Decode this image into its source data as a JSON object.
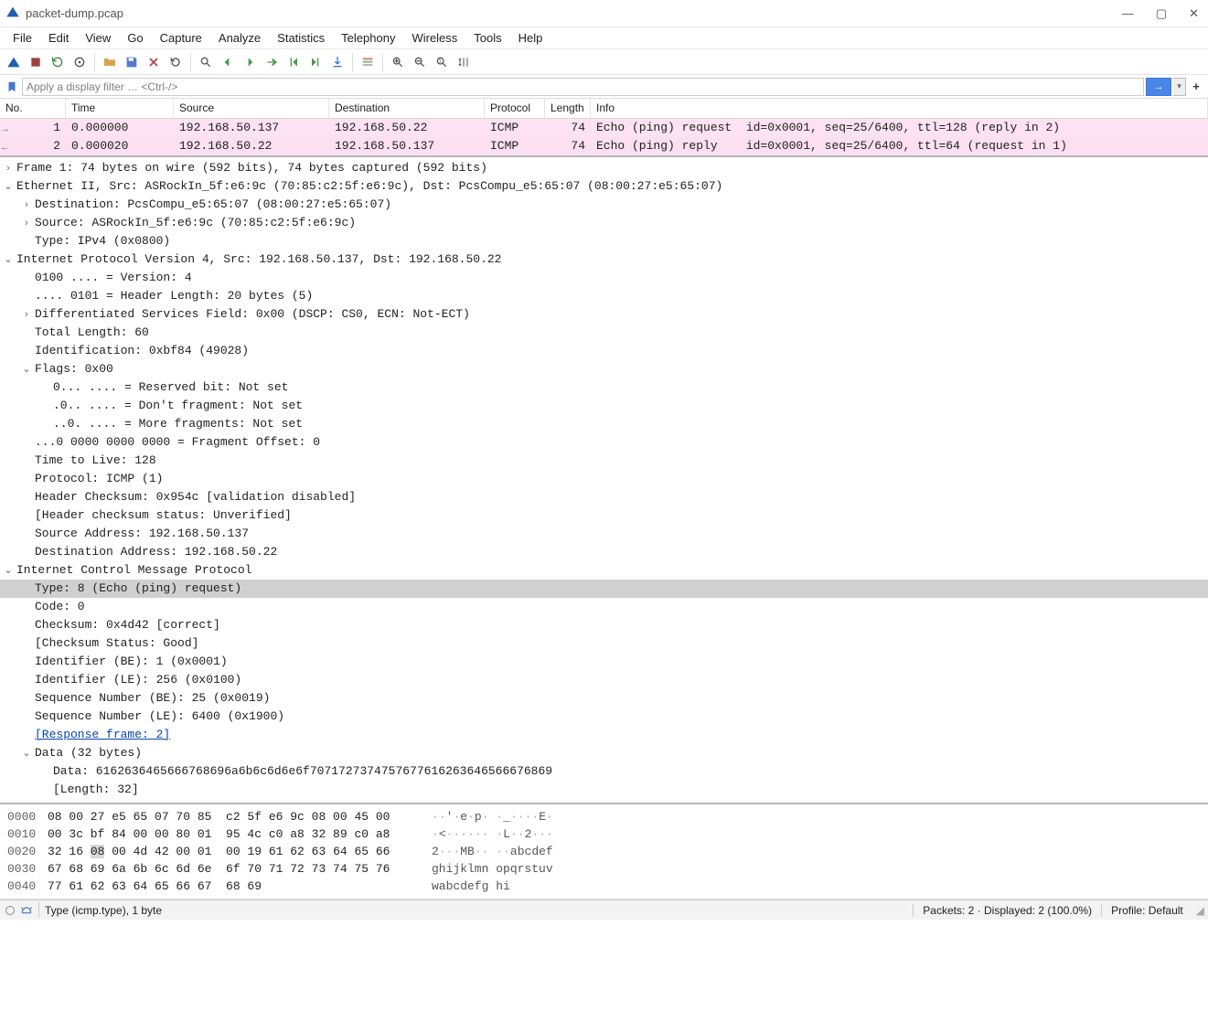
{
  "window": {
    "title": "packet-dump.pcap",
    "controls": {
      "min": "—",
      "max": "▢",
      "close": "✕"
    }
  },
  "menu": [
    "File",
    "Edit",
    "View",
    "Go",
    "Capture",
    "Analyze",
    "Statistics",
    "Telephony",
    "Wireless",
    "Tools",
    "Help"
  ],
  "filter": {
    "placeholder": "Apply a display filter … <Ctrl-/>",
    "go_label": "→",
    "plus": "+"
  },
  "packet_list": {
    "headers": [
      "No.",
      "Time",
      "Source",
      "Destination",
      "Protocol",
      "Length",
      "Info"
    ],
    "rows": [
      {
        "no": "1",
        "time": "0.000000",
        "src": "192.168.50.137",
        "dst": "192.168.50.22",
        "proto": "ICMP",
        "len": "74",
        "info": "Echo (ping) request  id=0x0001, seq=25/6400, ttl=128 (reply in 2)",
        "mark": "→"
      },
      {
        "no": "2",
        "time": "0.000020",
        "src": "192.168.50.22",
        "dst": "192.168.50.137",
        "proto": "ICMP",
        "len": "74",
        "info": "Echo (ping) reply    id=0x0001, seq=25/6400, ttl=64 (request in 1)",
        "mark": "←"
      }
    ]
  },
  "details": [
    {
      "lvl": 0,
      "exp": "closed",
      "txt": "Frame 1: 74 bytes on wire (592 bits), 74 bytes captured (592 bits)"
    },
    {
      "lvl": 0,
      "exp": "open",
      "txt": "Ethernet II, Src: ASRockIn_5f:e6:9c (70:85:c2:5f:e6:9c), Dst: PcsCompu_e5:65:07 (08:00:27:e5:65:07)"
    },
    {
      "lvl": 1,
      "exp": "closed",
      "txt": "Destination: PcsCompu_e5:65:07 (08:00:27:e5:65:07)"
    },
    {
      "lvl": 1,
      "exp": "closed",
      "txt": "Source: ASRockIn_5f:e6:9c (70:85:c2:5f:e6:9c)"
    },
    {
      "lvl": 1,
      "exp": "none",
      "txt": "Type: IPv4 (0x0800)"
    },
    {
      "lvl": 0,
      "exp": "open",
      "txt": "Internet Protocol Version 4, Src: 192.168.50.137, Dst: 192.168.50.22"
    },
    {
      "lvl": 1,
      "exp": "none",
      "txt": "0100 .... = Version: 4"
    },
    {
      "lvl": 1,
      "exp": "none",
      "txt": ".... 0101 = Header Length: 20 bytes (5)"
    },
    {
      "lvl": 1,
      "exp": "closed",
      "txt": "Differentiated Services Field: 0x00 (DSCP: CS0, ECN: Not-ECT)"
    },
    {
      "lvl": 1,
      "exp": "none",
      "txt": "Total Length: 60"
    },
    {
      "lvl": 1,
      "exp": "none",
      "txt": "Identification: 0xbf84 (49028)"
    },
    {
      "lvl": 1,
      "exp": "open",
      "txt": "Flags: 0x00"
    },
    {
      "lvl": 2,
      "exp": "none",
      "txt": "0... .... = Reserved bit: Not set"
    },
    {
      "lvl": 2,
      "exp": "none",
      "txt": ".0.. .... = Don't fragment: Not set"
    },
    {
      "lvl": 2,
      "exp": "none",
      "txt": "..0. .... = More fragments: Not set"
    },
    {
      "lvl": 1,
      "exp": "none",
      "txt": "...0 0000 0000 0000 = Fragment Offset: 0"
    },
    {
      "lvl": 1,
      "exp": "none",
      "txt": "Time to Live: 128"
    },
    {
      "lvl": 1,
      "exp": "none",
      "txt": "Protocol: ICMP (1)"
    },
    {
      "lvl": 1,
      "exp": "none",
      "txt": "Header Checksum: 0x954c [validation disabled]"
    },
    {
      "lvl": 1,
      "exp": "none",
      "txt": "[Header checksum status: Unverified]"
    },
    {
      "lvl": 1,
      "exp": "none",
      "txt": "Source Address: 192.168.50.137"
    },
    {
      "lvl": 1,
      "exp": "none",
      "txt": "Destination Address: 192.168.50.22"
    },
    {
      "lvl": 0,
      "exp": "open",
      "txt": "Internet Control Message Protocol"
    },
    {
      "lvl": 1,
      "exp": "none",
      "txt": "Type: 8 (Echo (ping) request)",
      "sel": true
    },
    {
      "lvl": 1,
      "exp": "none",
      "txt": "Code: 0"
    },
    {
      "lvl": 1,
      "exp": "none",
      "txt": "Checksum: 0x4d42 [correct]"
    },
    {
      "lvl": 1,
      "exp": "none",
      "txt": "[Checksum Status: Good]"
    },
    {
      "lvl": 1,
      "exp": "none",
      "txt": "Identifier (BE): 1 (0x0001)"
    },
    {
      "lvl": 1,
      "exp": "none",
      "txt": "Identifier (LE): 256 (0x0100)"
    },
    {
      "lvl": 1,
      "exp": "none",
      "txt": "Sequence Number (BE): 25 (0x0019)"
    },
    {
      "lvl": 1,
      "exp": "none",
      "txt": "Sequence Number (LE): 6400 (0x1900)"
    },
    {
      "lvl": 1,
      "exp": "none",
      "txt": "[Response frame: 2]",
      "link": true
    },
    {
      "lvl": 1,
      "exp": "open",
      "txt": "Data (32 bytes)"
    },
    {
      "lvl": 2,
      "exp": "none",
      "txt": "Data: 6162636465666768696a6b6c6d6e6f7071727374757677616263646566676869"
    },
    {
      "lvl": 2,
      "exp": "none",
      "txt": "[Length: 32]"
    }
  ],
  "hex": [
    {
      "off": "0000",
      "b": "08 00 27 e5 65 07 70 85  c2 5f e6 9c 08 00 45 00",
      "a": "··'·e·p· ·_····E·",
      "hl": []
    },
    {
      "off": "0010",
      "b": "00 3c bf 84 00 00 80 01  95 4c c0 a8 32 89 c0 a8",
      "a": "·<······ ·L··2···",
      "hl": []
    },
    {
      "off": "0020",
      "b": "32 16 08 00 4d 42 00 01  00 19 61 62 63 64 65 66",
      "a": "2···MB·· ··abcdef",
      "hl": [
        2
      ]
    },
    {
      "off": "0030",
      "b": "67 68 69 6a 6b 6c 6d 6e  6f 70 71 72 73 74 75 76",
      "a": "ghijklmn opqrstuv",
      "hl": []
    },
    {
      "off": "0040",
      "b": "77 61 62 63 64 65 66 67  68 69",
      "a": "wabcdefg hi",
      "hl": []
    }
  ],
  "statusbar": {
    "field": "Type (icmp.type), 1 byte",
    "packets": "Packets: 2 · Displayed: 2 (100.0%)",
    "profile": "Profile: Default"
  }
}
